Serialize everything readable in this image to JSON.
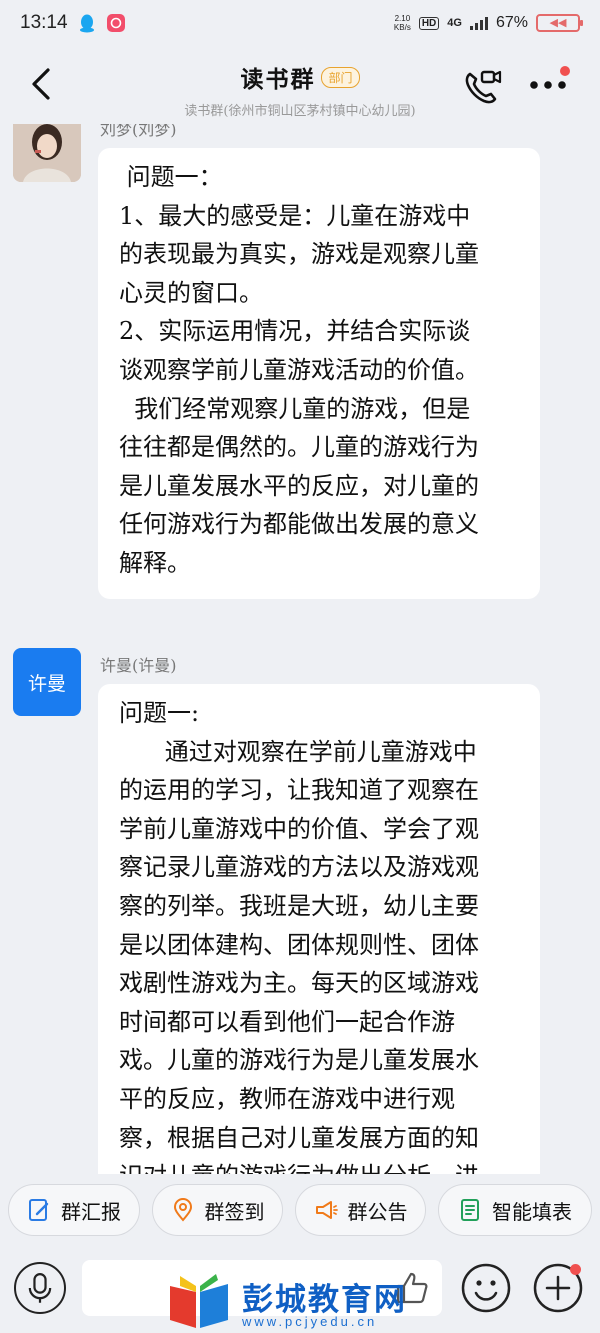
{
  "status_bar": {
    "time": "13:14",
    "speed_value": "2.10",
    "speed_unit": "KB/s",
    "hd": "HD",
    "network": "4G",
    "battery_percent": "67%"
  },
  "header": {
    "title": "读书群",
    "badge": "部门",
    "subtitle": "读书群(徐州市铜山区茅村镇中心幼儿园)"
  },
  "messages": [
    {
      "sender": "刘梦(刘梦)",
      "avatar_text": "",
      "lines": [
        " 问题一：",
        "1、最大的感受是：儿童在游戏中",
        "的表现最为真实，游戏是观察儿童",
        "心灵的窗口。",
        "2、实际运用情况，并结合实际谈",
        "谈观察学前儿童游戏活动的价值。",
        "  我们经常观察儿童的游戏，但是",
        "往往都是偶然的。儿童的游戏行为",
        "是儿童发展水平的反应，对儿童的",
        "任何游戏行为都能做出发展的意义",
        "解释。"
      ]
    },
    {
      "sender": "许曼(许曼)",
      "avatar_text": "许曼",
      "lines": [
        "问题一:",
        "      通过对观察在学前儿童游戏中",
        "的运用的学习，让我知道了观察在",
        "学前儿童游戏中的价值、学会了观",
        "察记录儿童游戏的方法以及游戏观",
        "察的列举。我班是大班，幼儿主要",
        "是以团体建构、团体规则性、团体",
        "戏剧性游戏为主。每天的区域游戏",
        "时间都可以看到他们一起合作游",
        "戏。儿童的游戏行为是儿童发展水",
        "平的反应，教师在游戏中进行观",
        "察，根据自己对儿童发展方面的知",
        "识对儿童的游戏行为做出分析，进"
      ]
    }
  ],
  "quick_actions": [
    {
      "label": "群汇报",
      "icon": "report-icon",
      "color": "#2a7be4"
    },
    {
      "label": "群签到",
      "icon": "location-pin-icon",
      "color": "#f07a1a"
    },
    {
      "label": "群公告",
      "icon": "megaphone-icon",
      "color": "#f07a1a"
    },
    {
      "label": "智能填表",
      "icon": "form-icon",
      "color": "#22a05a"
    }
  ],
  "watermark": {
    "text": "彭城教育网",
    "url": "www.pcjyedu.cn"
  }
}
